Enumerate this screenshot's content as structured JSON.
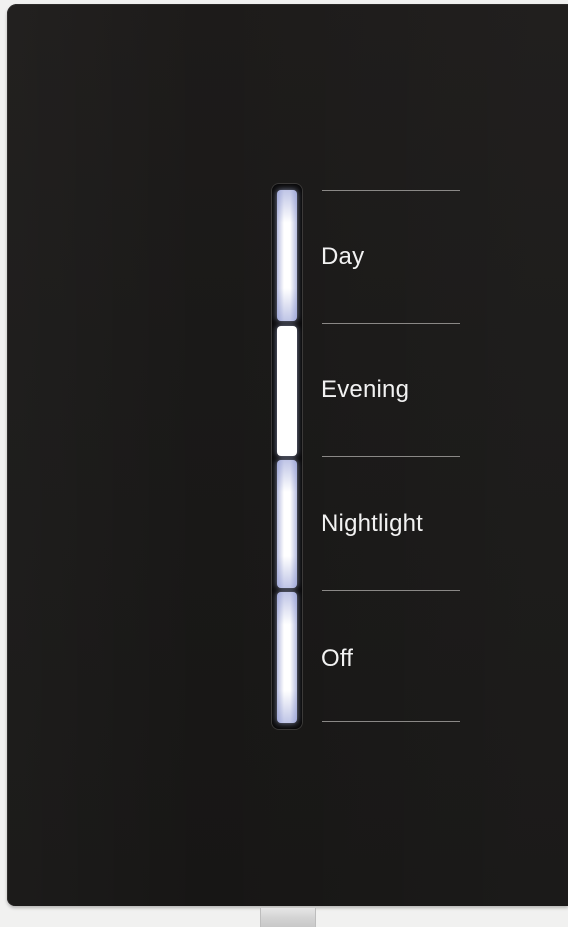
{
  "device": {
    "type": "lighting scene switch",
    "plate_color": "#1a1918",
    "indicator_color": "#ffffff",
    "selected_level": "Evening"
  },
  "levels": [
    {
      "label": "Day"
    },
    {
      "label": "Evening"
    },
    {
      "label": "Nightlight"
    },
    {
      "label": "Off"
    }
  ]
}
